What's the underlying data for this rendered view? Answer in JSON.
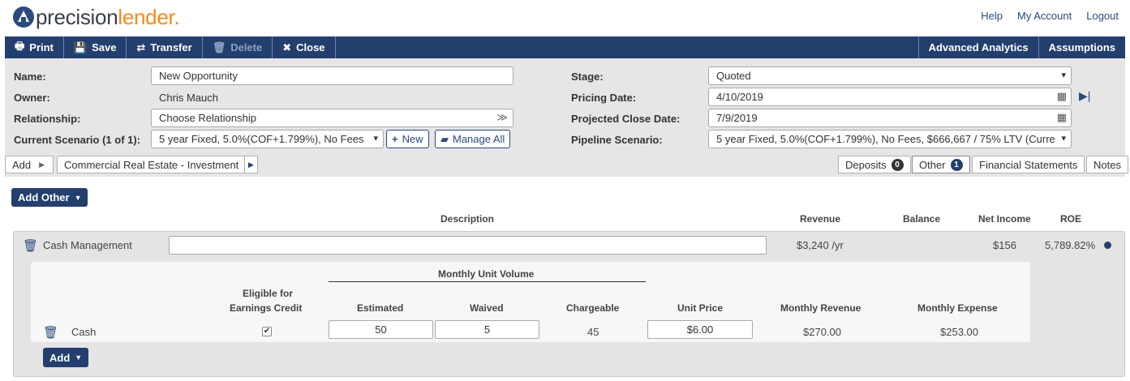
{
  "brand": {
    "part1": "precision",
    "part2": "lender",
    "dot": "."
  },
  "top_links": {
    "help": "Help",
    "account": "My Account",
    "logout": "Logout"
  },
  "toolbar": {
    "print": "Print",
    "save": "Save",
    "transfer": "Transfer",
    "delete": "Delete",
    "close": "Close",
    "analytics": "Advanced Analytics",
    "assumptions": "Assumptions"
  },
  "form": {
    "name_label": "Name:",
    "name_value": "New Opportunity",
    "owner_label": "Owner:",
    "owner_value": "Chris Mauch",
    "relationship_label": "Relationship:",
    "relationship_value": "Choose Relationship",
    "scenario_label": "Current Scenario (1 of 1):",
    "scenario_value": "5 year Fixed, 5.0%(COF+1.799%), No Fees",
    "new_label": "New",
    "manage_label": "Manage All",
    "stage_label": "Stage:",
    "stage_value": "Quoted",
    "pricing_date_label": "Pricing Date:",
    "pricing_date_value": "4/10/2019",
    "close_date_label": "Projected Close Date:",
    "close_date_value": "7/9/2019",
    "pipeline_label": "Pipeline Scenario:",
    "pipeline_value": "5 year Fixed, 5.0%(COF+1.799%), No Fees, $666,667 / 75% LTV (Curre"
  },
  "tabs": {
    "add": "Add",
    "loan": "Commercial Real Estate - Investment",
    "deposits": "Deposits",
    "deposits_count": "0",
    "other": "Other",
    "other_count": "1",
    "financial": "Financial Statements",
    "notes": "Notes"
  },
  "add_other": "Add Other",
  "table_headers": {
    "description": "Description",
    "revenue": "Revenue",
    "balance": "Balance",
    "net_income": "Net Income",
    "roe": "ROE"
  },
  "row": {
    "name": "Cash Management",
    "description": "",
    "revenue": "$3,240 /yr",
    "balance": "",
    "net_income": "$156",
    "roe": "5,789.82%"
  },
  "detail": {
    "group_header": "Monthly Unit Volume",
    "eligible_line1": "Eligible for",
    "eligible_line2": "Earnings Credit",
    "estimated": "Estimated",
    "waived": "Waived",
    "chargeable": "Chargeable",
    "unit_price": "Unit Price",
    "monthly_revenue": "Monthly Revenue",
    "monthly_expense": "Monthly Expense",
    "item_name": "Cash",
    "eligible_checked": "✔",
    "estimated_value": "50",
    "waived_value": "5",
    "chargeable_value": "45",
    "unit_price_value": "$6.00",
    "monthly_revenue_value": "$270.00",
    "monthly_expense_value": "$253.00"
  },
  "add_label": "Add",
  "colors": {
    "navy": "#233f6e",
    "orange": "#f28c1c"
  }
}
